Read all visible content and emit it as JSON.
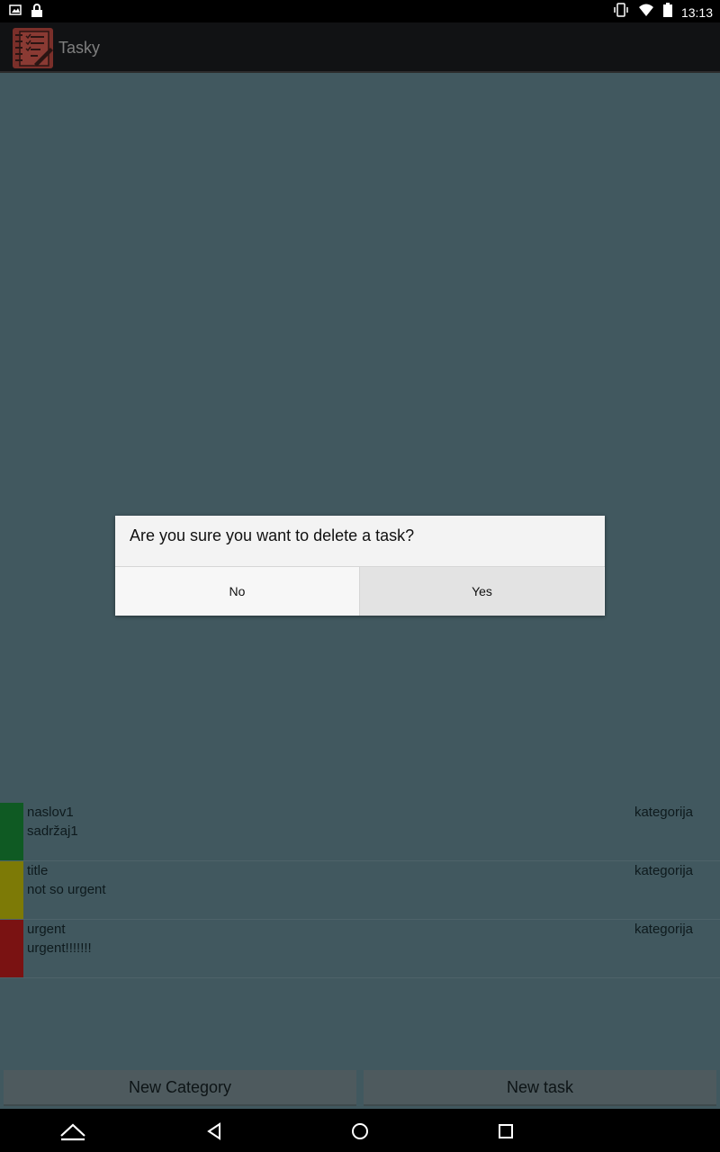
{
  "status_bar": {
    "time": "13:13",
    "icons_left": [
      "image-icon",
      "lock-icon"
    ],
    "icons_right": [
      "vibrate-icon",
      "wifi-icon",
      "battery-icon"
    ]
  },
  "app_bar": {
    "title": "Tasky",
    "icon": "notebook-checklist-icon"
  },
  "dialog": {
    "message": "Are you sure you want to delete a task?",
    "no_label": "No",
    "yes_label": "Yes"
  },
  "tasks": [
    {
      "title": "naslov1",
      "body": "sadržaj1",
      "category": "kategorija",
      "color": "#0f5a23"
    },
    {
      "title": "title",
      "body": "not so urgent",
      "category": "kategorija",
      "color": "#7d7a06"
    },
    {
      "title": "urgent",
      "body": "urgent!!!!!!!",
      "category": "kategorija",
      "color": "#7a1212"
    }
  ],
  "buttons": {
    "new_category": "New Category",
    "new_task": "New task"
  },
  "nav_bar": [
    "home-up-icon",
    "back-icon",
    "home-icon",
    "recents-icon"
  ],
  "colors": {
    "background": "#41585f",
    "dialog": "#f3f3f3",
    "yes_pressed": "#e3e3e3"
  }
}
